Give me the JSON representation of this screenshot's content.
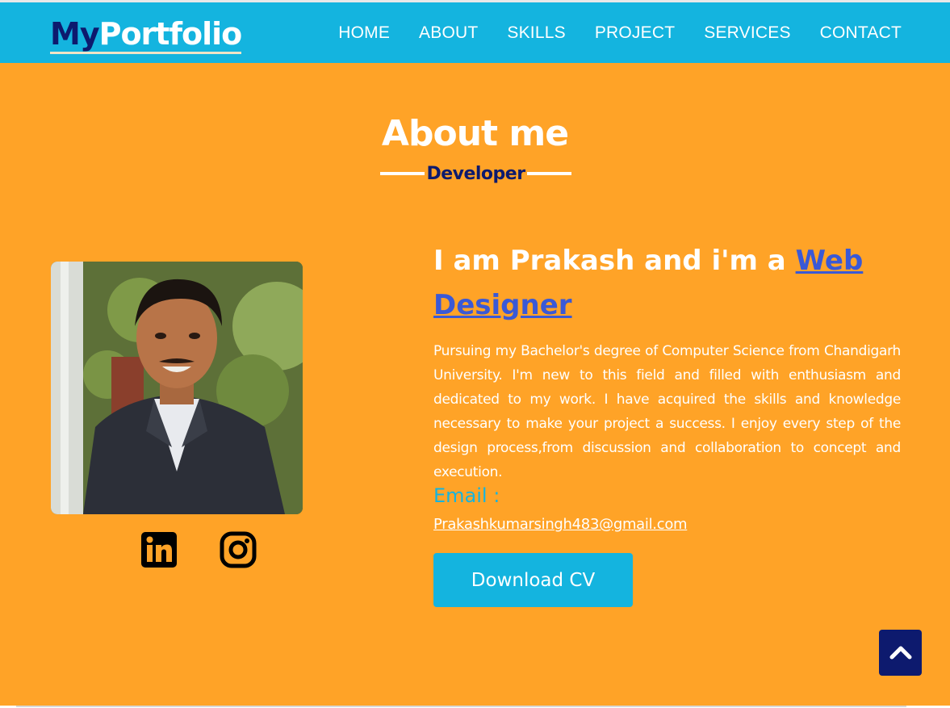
{
  "header": {
    "logo": {
      "part1": "My",
      "part2": "Portfolio"
    },
    "nav": [
      {
        "label": "HOME"
      },
      {
        "label": "ABOUT"
      },
      {
        "label": "SKILLS"
      },
      {
        "label": "PROJECT"
      },
      {
        "label": "SERVICES"
      },
      {
        "label": "CONTACT"
      }
    ]
  },
  "about": {
    "title": "About me",
    "subtitle": "Developer",
    "intro_prefix": "I am Prakash and i'm a ",
    "intro_role": "Web Designer",
    "description": "Pursuing my Bachelor's degree of Computer Science from Chandigarh University. I'm new to this field and filled with enthusiasm and dedicated to my work. I have acquired the skills and knowledge necessary to make your project a success. I enjoy every step of the design process,from discussion and collaboration to concept and execution.",
    "email_label": "Email :",
    "email": "Prakashkumarsingh483@gmail.com",
    "cv_button": "Download CV",
    "social": [
      {
        "icon": "linkedin-icon"
      },
      {
        "icon": "instagram-icon"
      }
    ]
  },
  "colors": {
    "header_bg": "#14b4df",
    "section_bg": "#ffa327",
    "navy": "#0d1a6e",
    "link_blue": "#3a59d6"
  }
}
